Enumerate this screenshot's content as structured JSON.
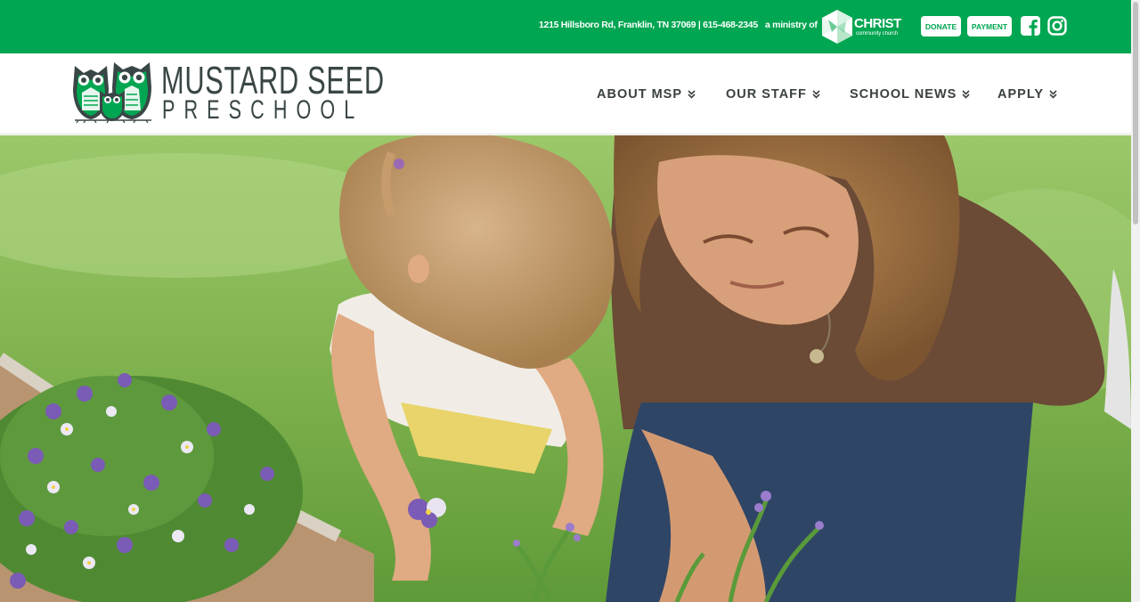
{
  "topbar": {
    "address": "1215 Hillsboro Rd, Franklin, TN 37069 | 615-468-2345",
    "ministry_text": "a ministry of",
    "church_logo": {
      "word": "CHRIST",
      "sub": "community church"
    },
    "donate_label": "DONATE",
    "payment_label": "PAYMENT",
    "social_icons": [
      "facebook-icon",
      "instagram-icon"
    ],
    "background_color": "#00a651"
  },
  "header": {
    "logo": {
      "line1": "MUSTARD SEED",
      "line2": "PRESCHOOL"
    },
    "nav": [
      {
        "label": "ABOUT MSP"
      },
      {
        "label": "OUR STAFF"
      },
      {
        "label": "SCHOOL NEWS"
      },
      {
        "label": "APPLY"
      }
    ]
  },
  "hero": {
    "image_subject": "child and woman planting flowers in a garden"
  },
  "colors": {
    "brand_green": "#00a651",
    "text_dark": "#3a4646"
  }
}
